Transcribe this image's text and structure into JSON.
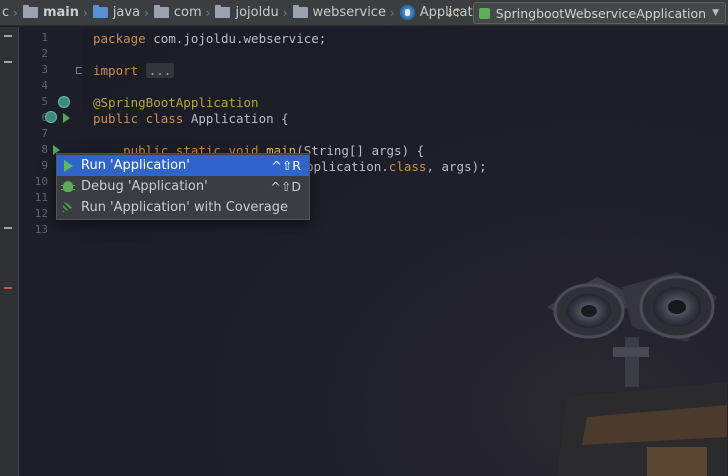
{
  "breadcrumb": {
    "partial": "c",
    "items": [
      {
        "label": "main",
        "icon": "module-folder-icon"
      },
      {
        "label": "java",
        "icon": "source-folder-icon"
      },
      {
        "label": "com",
        "icon": "package-icon"
      },
      {
        "label": "jojoldu",
        "icon": "package-icon"
      },
      {
        "label": "webservice",
        "icon": "package-icon"
      },
      {
        "label": "Application",
        "icon": "spring-class-icon"
      }
    ]
  },
  "run_config": {
    "label": "SpringbootWebserviceApplication"
  },
  "line_numbers": [
    "1",
    "2",
    "3",
    "4",
    "5",
    "6",
    "7",
    "8",
    "9",
    "10",
    "11",
    "12",
    "13"
  ],
  "code": {
    "line1_kw": "package",
    "line1_rest": " com.jojoldu.webservice;",
    "line3_kw": "import",
    "line3_fold": "...",
    "line6": "@SpringBootApplication",
    "line7_kw": "public class",
    "line7_rest": " Application {",
    "line9_kw": "public static void",
    "line9_fn": "main",
    "line9_rest": "(String[] args) {",
    "line10_visible": "pplication.",
    "line10_kw": "class",
    "line10_rest": ", args);"
  },
  "popup": {
    "items": [
      {
        "label": "Run 'Application'",
        "shortcut": "^⇧R",
        "icon": "run-icon"
      },
      {
        "label": "Debug 'Application'",
        "shortcut": "^⇧D",
        "icon": "debug-icon"
      },
      {
        "label": "Run 'Application' with Coverage",
        "shortcut": "",
        "icon": "coverage-icon"
      }
    ]
  },
  "colors": {
    "background": "#1b1d27",
    "keyword": "#d08c4c",
    "annotation": "#b4a83c",
    "selection": "#2f65ca",
    "run_green": "#5fb95f"
  }
}
